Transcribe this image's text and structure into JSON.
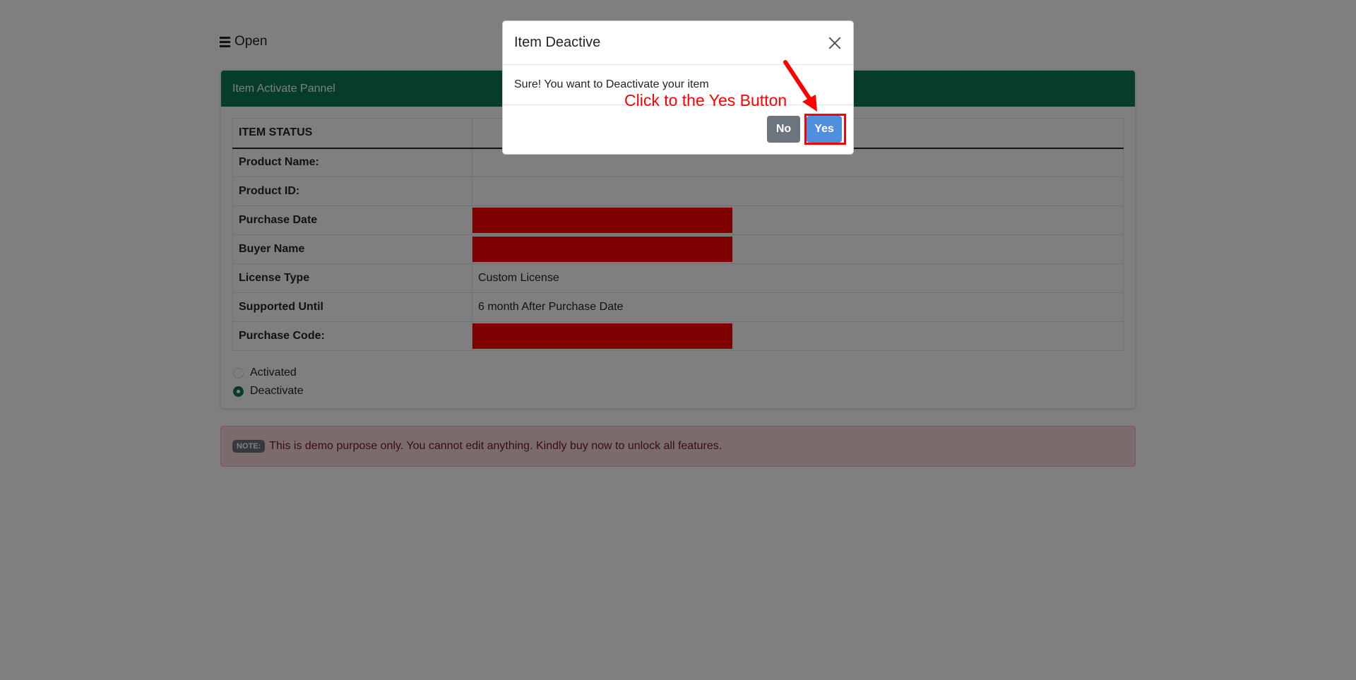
{
  "toggle": {
    "label": "Open"
  },
  "card": {
    "header": "Item Activate Pannel",
    "table_header": "ITEM STATUS",
    "rows": [
      {
        "label": "Product Name:",
        "value": ""
      },
      {
        "label": "Product ID:",
        "value": ""
      },
      {
        "label": "Purchase Date",
        "value": ""
      },
      {
        "label": "Buyer Name",
        "value": ""
      },
      {
        "label": "License Type",
        "value": "Custom License"
      },
      {
        "label": "Supported Until",
        "value": "6 month After Purchase Date"
      },
      {
        "label": "Purchase Code:",
        "value": ""
      }
    ],
    "radios": [
      {
        "label": "Activated",
        "checked": false
      },
      {
        "label": "Deactivate",
        "checked": true
      }
    ]
  },
  "note": {
    "badge": "NOTE:",
    "text": "This is demo purpose only. You cannot edit anything. Kindly buy now to unlock all features."
  },
  "modal": {
    "title": "Item Deactive",
    "body": "Sure! You want to Deactivate your item",
    "no_label": "No",
    "yes_label": "Yes"
  },
  "annotation": {
    "text": "Click to the Yes Button"
  },
  "colors": {
    "accent": "#0b7a55",
    "yes_button": "#4f8fe0",
    "no_button": "#6c757d",
    "redaction": "#ff0000",
    "annotation": "#ff0000"
  }
}
